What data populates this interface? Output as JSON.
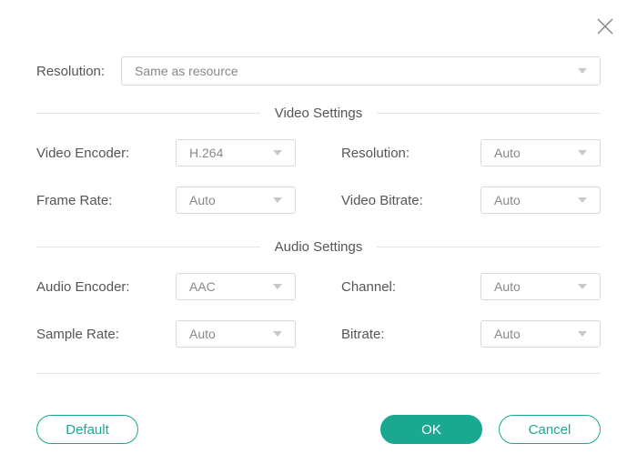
{
  "close": "×",
  "top": {
    "label": "Resolution:",
    "value": "Same as resource"
  },
  "videoSection": {
    "title": "Video Settings",
    "encoder": {
      "label": "Video Encoder:",
      "value": "H.264"
    },
    "resolution": {
      "label": "Resolution:",
      "value": "Auto"
    },
    "frameRate": {
      "label": "Frame Rate:",
      "value": "Auto"
    },
    "bitrate": {
      "label": "Video Bitrate:",
      "value": "Auto"
    }
  },
  "audioSection": {
    "title": "Audio Settings",
    "encoder": {
      "label": "Audio Encoder:",
      "value": "AAC"
    },
    "channel": {
      "label": "Channel:",
      "value": "Auto"
    },
    "sampleRate": {
      "label": "Sample Rate:",
      "value": "Auto"
    },
    "bitrate": {
      "label": "Bitrate:",
      "value": "Auto"
    }
  },
  "buttons": {
    "default": "Default",
    "ok": "OK",
    "cancel": "Cancel"
  }
}
